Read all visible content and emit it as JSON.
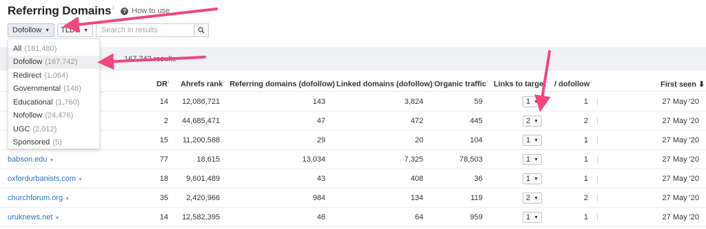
{
  "header": {
    "title": "Referring Domains",
    "info_mark": "i",
    "howto_icon": "?",
    "howto_label": "How to use"
  },
  "filters": {
    "follow_selected": "Dofollow",
    "tld_label": "TLDs",
    "search_placeholder": "Search in results"
  },
  "menu": {
    "items": [
      {
        "label": "All",
        "count": "(181,480)"
      },
      {
        "label": "Dofollow",
        "count": "(167,742)"
      },
      {
        "label": "Redirect",
        "count": "(1,064)"
      },
      {
        "label": "Governmental",
        "count": "(146)"
      },
      {
        "label": "Educational",
        "count": "(1,760)"
      },
      {
        "label": "Nofollow",
        "count": "(24,476)"
      },
      {
        "label": "UGC",
        "count": "(2,012)"
      },
      {
        "label": "Sponsored",
        "count": "(5)"
      }
    ]
  },
  "results": {
    "count_text": "167,742 results"
  },
  "table": {
    "headers": {
      "dr": "DR",
      "ahrefs_rank": "Ahrefs rank",
      "referring_domains": "Referring domains (dofollow)",
      "linked_domains": "Linked domains (dofollow)",
      "organic_traffic": "Organic traffic",
      "links_to_target": "Links to target",
      "dofollow": "/ dofollow",
      "first_seen": "First seen ⬇"
    },
    "rows": [
      {
        "domain": "",
        "dr": "14",
        "rank": "12,086,721",
        "ref": "143",
        "linked": "3,824",
        "traffic": "59",
        "links": "1",
        "dofollow": "1",
        "first_seen": "27 May '20"
      },
      {
        "domain": "",
        "dr": "2",
        "rank": "44,685,471",
        "ref": "47",
        "linked": "472",
        "traffic": "445",
        "links": "2",
        "dofollow": "2",
        "first_seen": "27 May '20"
      },
      {
        "domain": "",
        "dr": "15",
        "rank": "11,200,588",
        "ref": "29",
        "linked": "20",
        "traffic": "104",
        "links": "1",
        "dofollow": "1",
        "first_seen": "27 May '20"
      },
      {
        "domain": "babson.edu",
        "dr": "77",
        "rank": "18,615",
        "ref": "13,034",
        "linked": "7,325",
        "traffic": "78,503",
        "links": "1",
        "dofollow": "1",
        "first_seen": "27 May '20"
      },
      {
        "domain": "oxfordurbanists.com",
        "dr": "18",
        "rank": "9,601,489",
        "ref": "43",
        "linked": "408",
        "traffic": "36",
        "links": "1",
        "dofollow": "1",
        "first_seen": "27 May '20"
      },
      {
        "domain": "churchforum.org",
        "dr": "35",
        "rank": "2,420,966",
        "ref": "984",
        "linked": "134",
        "traffic": "119",
        "links": "2",
        "dofollow": "2",
        "first_seen": "27 May '20"
      },
      {
        "domain": "uruknews.net",
        "dr": "14",
        "rank": "12,582,395",
        "ref": "46",
        "linked": "64",
        "traffic": "959",
        "links": "1",
        "dofollow": "1",
        "first_seen": "27 May '20"
      }
    ]
  },
  "colors": {
    "link": "#2a6fc9",
    "annotation_arrow": "#f0477d",
    "results_bar": "#f0f1f4"
  }
}
